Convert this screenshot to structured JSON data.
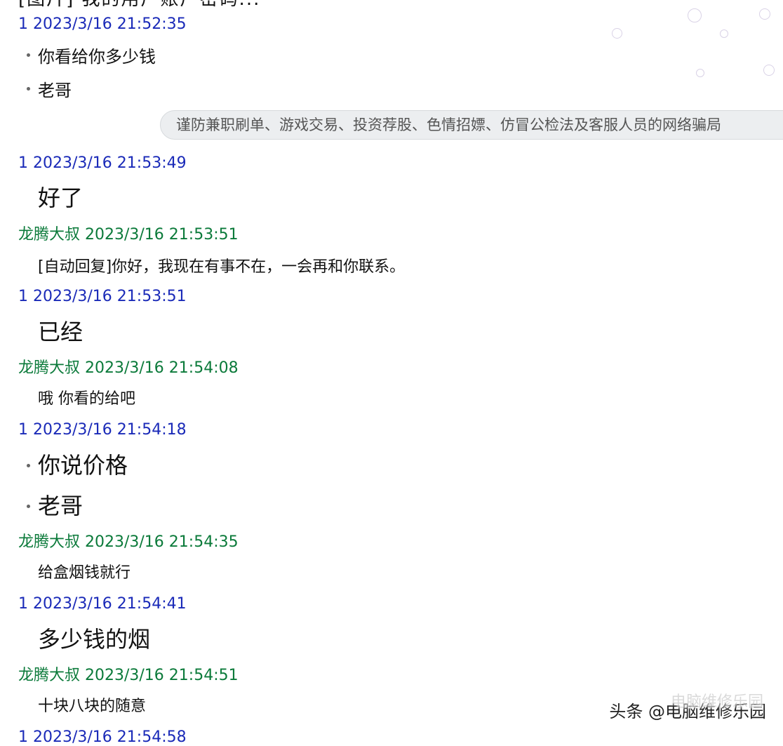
{
  "top_cutoff": "[图片] 我的用户账户密码...",
  "notice": "谨防兼职刷单、游戏交易、投资荐股、色情招嫖、仿冒公检法及客服人员的网络骗局",
  "watermark": {
    "text": "头条 @电脑维修乐园",
    "ghost": "电脑维修乐园"
  },
  "colors": {
    "self_header": "#1a2ab8",
    "friend_header": "#0b7a3a",
    "notice_bg": "#eceef0"
  },
  "entries": [
    {
      "kind": "self",
      "header": "1 2023/3/16 21:52:35"
    },
    {
      "kind": "msg",
      "text": "你看给你多少钱",
      "bullet": true
    },
    {
      "kind": "msg",
      "text": "老哥",
      "bullet": true
    },
    {
      "kind": "self",
      "header": "1 2023/3/16 21:53:49"
    },
    {
      "kind": "msg",
      "text": "好了"
    },
    {
      "kind": "friend",
      "header": "龙腾大叔 2023/3/16 21:53:51"
    },
    {
      "kind": "msg",
      "text": "[自动回复]你好，我现在有事不在，一会再和你联系。"
    },
    {
      "kind": "self",
      "header": "1 2023/3/16 21:53:51"
    },
    {
      "kind": "msg",
      "text": "已经"
    },
    {
      "kind": "friend",
      "header": "龙腾大叔 2023/3/16 21:54:08"
    },
    {
      "kind": "msg",
      "text": "哦 你看的给吧"
    },
    {
      "kind": "self",
      "header": "1 2023/3/16 21:54:18"
    },
    {
      "kind": "msg",
      "text": "你说价格",
      "bullet": true
    },
    {
      "kind": "msg",
      "text": "老哥",
      "bullet": true
    },
    {
      "kind": "friend",
      "header": "龙腾大叔 2023/3/16 21:54:35"
    },
    {
      "kind": "msg",
      "text": "给盒烟钱就行"
    },
    {
      "kind": "self",
      "header": "1 2023/3/16 21:54:41"
    },
    {
      "kind": "msg",
      "text": "多少钱的烟"
    },
    {
      "kind": "friend",
      "header": "龙腾大叔 2023/3/16 21:54:51"
    },
    {
      "kind": "msg",
      "text": "十块八块的随意"
    },
    {
      "kind": "self",
      "header": "1 2023/3/16 21:54:58"
    }
  ]
}
